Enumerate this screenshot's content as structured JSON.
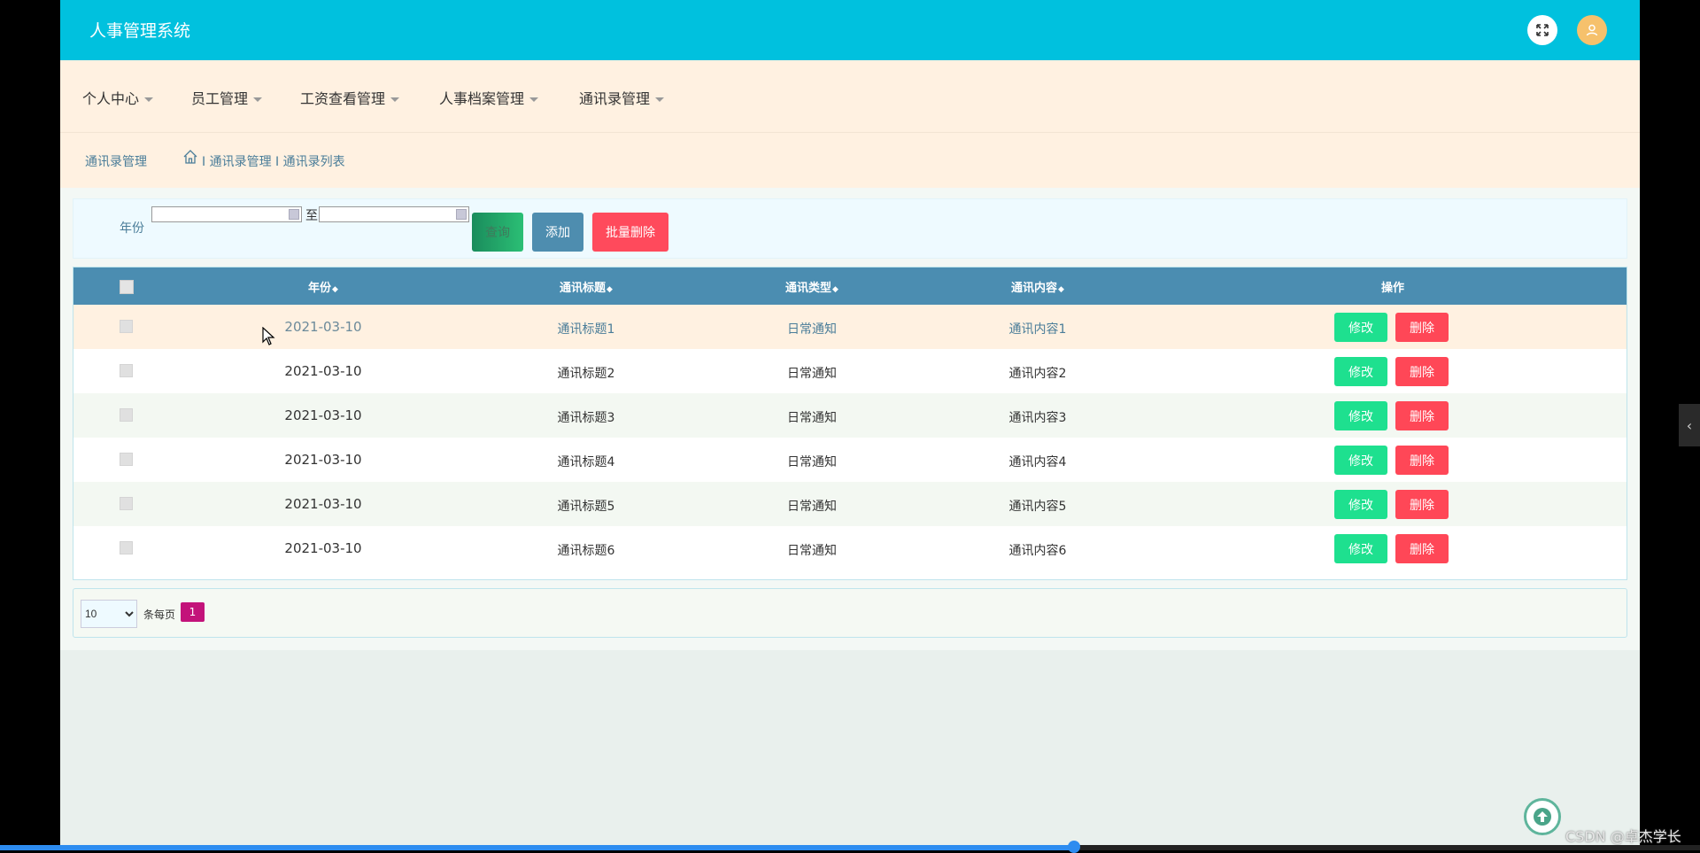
{
  "header": {
    "title": "人事管理系统"
  },
  "nav": [
    {
      "label": "个人中心"
    },
    {
      "label": "员工管理"
    },
    {
      "label": "工资查看管理"
    },
    {
      "label": "人事档案管理"
    },
    {
      "label": "通讯录管理"
    }
  ],
  "breadcrumb": {
    "title": "通讯录管理",
    "path": "I 通讯录管理 I 通讯录列表"
  },
  "search": {
    "label": "年份",
    "to_label": "至",
    "search_button": "查询",
    "add_button": "添加",
    "batch_delete_button": "批量删除"
  },
  "table": {
    "headers": [
      "年份",
      "通讯标题",
      "通讯类型",
      "通讯内容",
      "操作"
    ],
    "sort_icon": "◆",
    "rows": [
      {
        "year": "2021-03-10",
        "title": "通讯标题1",
        "type": "日常通知",
        "content": "通讯内容1"
      },
      {
        "year": "2021-03-10",
        "title": "通讯标题2",
        "type": "日常通知",
        "content": "通讯内容2"
      },
      {
        "year": "2021-03-10",
        "title": "通讯标题3",
        "type": "日常通知",
        "content": "通讯内容3"
      },
      {
        "year": "2021-03-10",
        "title": "通讯标题4",
        "type": "日常通知",
        "content": "通讯内容4"
      },
      {
        "year": "2021-03-10",
        "title": "通讯标题5",
        "type": "日常通知",
        "content": "通讯内容5"
      },
      {
        "year": "2021-03-10",
        "title": "通讯标题6",
        "type": "日常通知",
        "content": "通讯内容6"
      }
    ],
    "edit_label": "修改",
    "delete_label": "删除"
  },
  "pager": {
    "page_size": "10",
    "page_size_label": "条每页",
    "current_page": "1"
  },
  "watermark": "CSDN @卓杰学长",
  "colors": {
    "header": "#00c1de",
    "nav_bg": "#fff1e1",
    "table_header": "#4b8db1",
    "edit": "#1ee08f",
    "delete": "#ff4757",
    "page_active": "#c3137a"
  },
  "video_progress": 0.632
}
